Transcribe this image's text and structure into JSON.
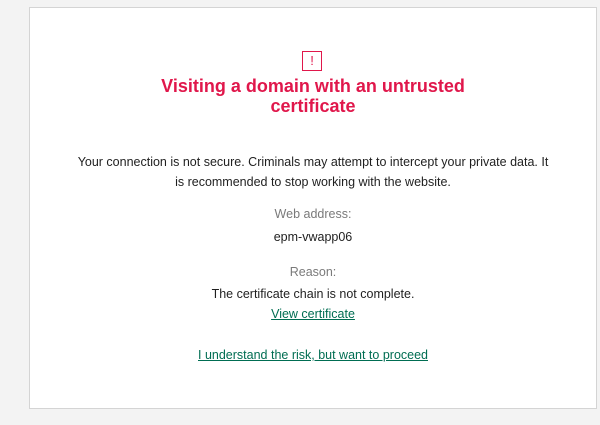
{
  "page": {
    "title": "Visiting a domain with an untrusted certificate",
    "warning_glyph": "!",
    "description": "Your connection is not secure. Criminals may attempt to intercept your private data. It is recommended to stop working with the website.",
    "web_address_label": "Web address:",
    "web_address_value": "epm-vwapp06",
    "reason_label": "Reason:",
    "reason_value": "The certificate chain is not complete.",
    "view_certificate_link": "View certificate",
    "proceed_link": "I understand the risk, but want to proceed"
  },
  "colors": {
    "accent_red": "#e0174b",
    "link_green": "#006d52",
    "label_gray": "#7a7a7a",
    "text_dark": "#1f1f1f",
    "background": "#f3f3f3"
  },
  "icons": {
    "warning": "exclamation-warning-icon"
  }
}
